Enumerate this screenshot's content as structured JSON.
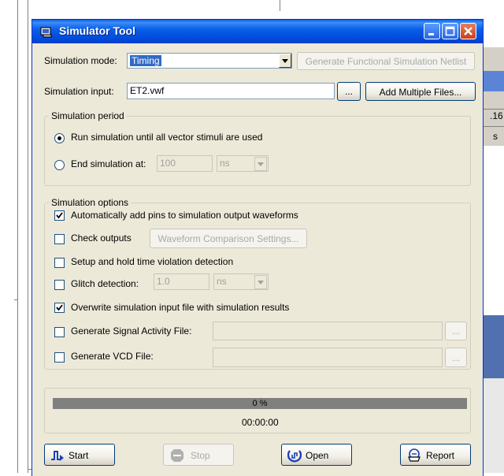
{
  "background": {
    "right_tab_label": ".16",
    "right_tab_label2": "s"
  },
  "window": {
    "title": "Simulator Tool"
  },
  "mode": {
    "label": "Simulation mode:",
    "value": "Timing",
    "netlist_button": "Generate Functional Simulation Netlist"
  },
  "input": {
    "label": "Simulation input:",
    "value": "ET2.vwf",
    "browse_button": "...",
    "add_multiple_button": "Add Multiple Files..."
  },
  "period": {
    "title": "Simulation period",
    "run_all_label": "Run simulation until all vector stimuli are used",
    "end_label": "End simulation at:",
    "end_value": "100",
    "end_unit": "ns",
    "run_all_selected": true
  },
  "options": {
    "title": "Simulation options",
    "auto_add_pins": {
      "label": "Automatically add pins to simulation output waveforms",
      "checked": true
    },
    "check_outputs": {
      "label": "Check outputs",
      "checked": false,
      "button": "Waveform Comparison Settings..."
    },
    "setup_hold": {
      "label": "Setup and hold time violation detection",
      "checked": false
    },
    "glitch": {
      "label": "Glitch detection:",
      "checked": false,
      "value": "1.0",
      "unit": "ns"
    },
    "overwrite": {
      "label": "Overwrite simulation input file with simulation results",
      "checked": true
    },
    "signal_activity": {
      "label": "Generate Signal Activity File:",
      "checked": false,
      "browse": "..."
    },
    "vcd": {
      "label": "Generate VCD File:",
      "checked": false,
      "browse": "..."
    }
  },
  "progress": {
    "percent_text": "0 %",
    "fraction": 0,
    "elapsed": "00:00:00"
  },
  "buttons": {
    "start": "Start",
    "stop": "Stop",
    "open": "Open",
    "report": "Report"
  },
  "colors": {
    "titlebar": "#0A5FE8",
    "dialog_bg": "#ECE9D8",
    "selection": "#316AC5",
    "progress_track": "#808080"
  }
}
